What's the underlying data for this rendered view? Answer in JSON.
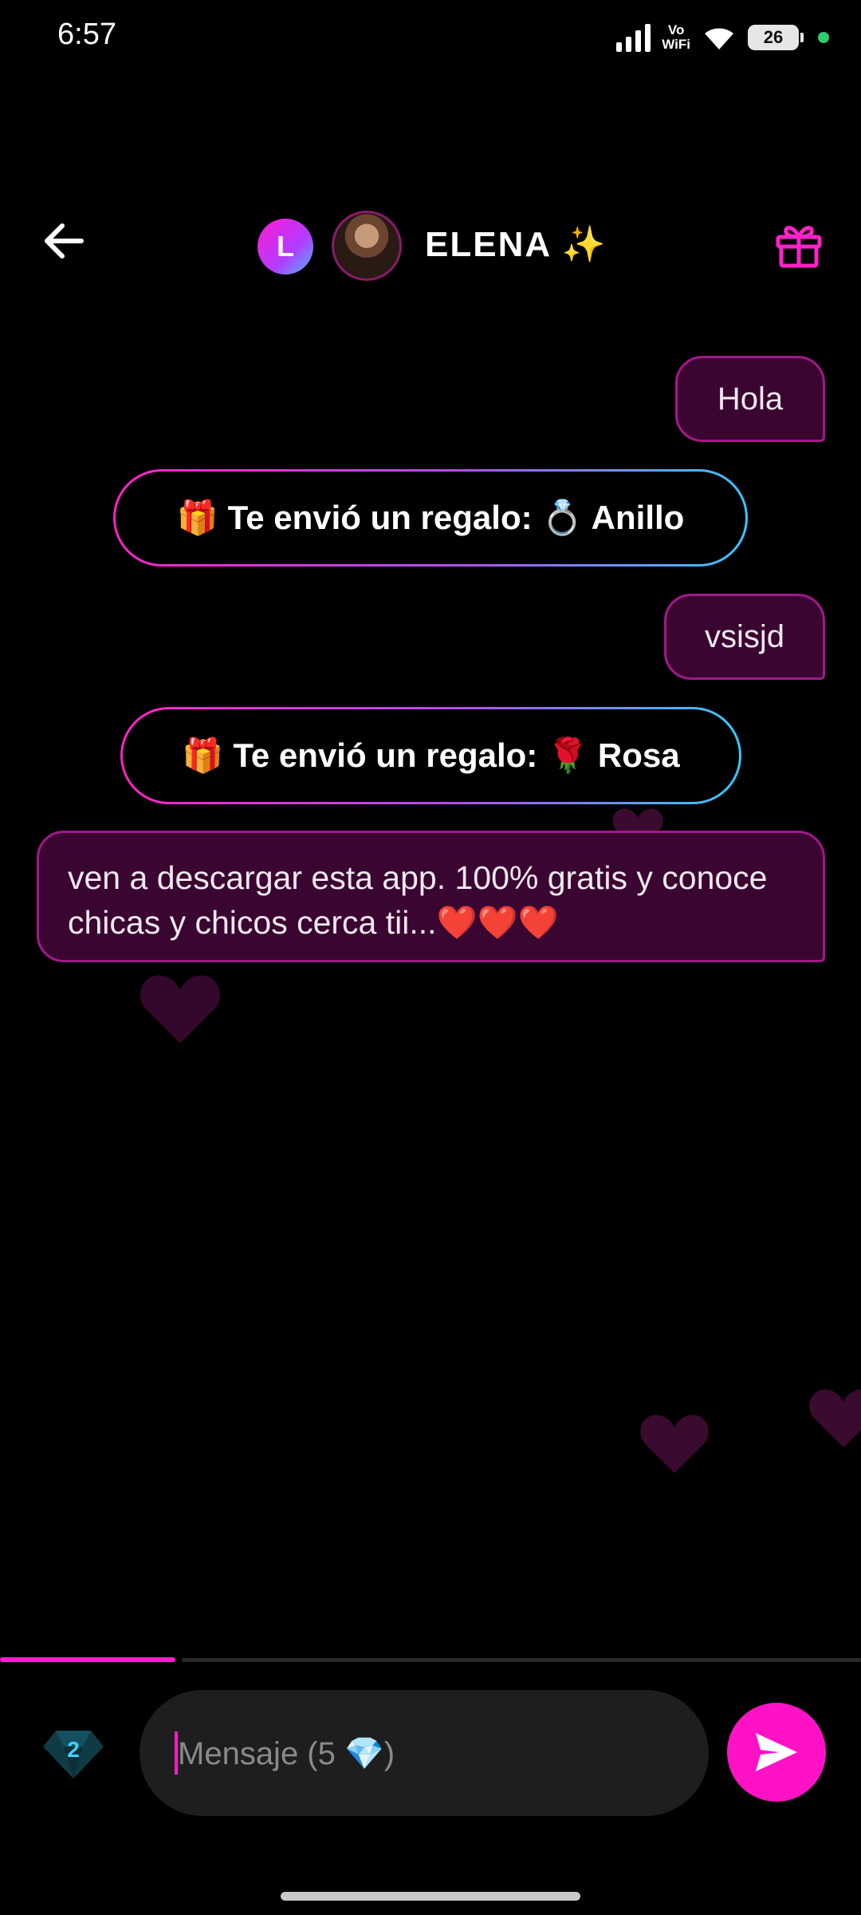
{
  "status_bar": {
    "time": "6:57",
    "vowifi_top": "Vo",
    "vowifi_bottom": "WiFi",
    "battery": "26"
  },
  "header": {
    "level_letter": "L",
    "contact_name": "ELENA ✨"
  },
  "messages": [
    {
      "type": "outgoing",
      "text": "Hola"
    },
    {
      "type": "gift",
      "text": "🎁 Te envió un regalo: 💍 Anillo"
    },
    {
      "type": "outgoing",
      "text": "vsisjd"
    },
    {
      "type": "gift",
      "text": "🎁 Te envió un regalo: 🌹 Rosa"
    },
    {
      "type": "outgoing",
      "text": "ven a descargar esta app. 100% gratis y conoce chicas y chicos cerca tii...❤️❤️❤️"
    }
  ],
  "composer": {
    "diamond_count": "2",
    "placeholder": "Mensaje (5 💎)",
    "value": ""
  },
  "colors": {
    "accent": "#ff12c6",
    "bubble_bg": "#3a0530",
    "bubble_border": "#a3188a",
    "gift_gradient_end": "#35c9ff"
  },
  "icons": {
    "back": "arrow-left-icon",
    "gift": "gift-box-icon",
    "diamond": "diamond-icon",
    "send": "send-icon"
  }
}
